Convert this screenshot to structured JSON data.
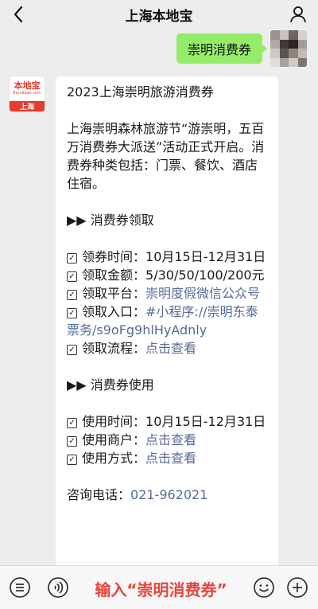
{
  "header": {
    "title": "上海本地宝",
    "back_icon": "chevron-left-icon",
    "profile_icon": "person-icon"
  },
  "outgoing": {
    "text": "崇明消费券"
  },
  "bot": {
    "logo_main": "本地宝",
    "logo_sub": "Bendibao.com",
    "logo_city": "上海"
  },
  "message": {
    "title": "2023上海崇明旅游消费券",
    "intro": "上海崇明森林旅游节“游崇明，五百万消费券大派送”活动正式开启。消费券种类包括：门票、餐饮、酒店住宿。",
    "section1_heading": "▶▶ 消费券领取",
    "get_time_label": "领券时间：",
    "get_time_value": "10月15日-12月31日",
    "amount_label": "领取金额：",
    "amount_value": "5/30/50/100/200元",
    "platform_label": "领取平台：",
    "platform_value": "崇明度假微信公众号",
    "entry_label": "领取入口：",
    "entry_value": "#小程序://崇明东泰票务/s9oFg9hlHyAdnly",
    "process_label": "领取流程：",
    "process_value": "点击查看",
    "section2_heading": "▶▶ 消费券使用",
    "use_time_label": "使用时间：",
    "use_time_value": "10月15日-12月31日",
    "merchant_label": "使用商户：",
    "merchant_value": "点击查看",
    "method_label": "使用方式：",
    "method_value": "点击查看",
    "phone_label": "咨询电话：",
    "phone_value": "021-962021"
  },
  "input_bar": {
    "hint": "输入“崇明消费券”",
    "menu_icon": "menu-list-icon",
    "voice_icon": "voice-icon",
    "emoji_icon": "emoji-icon",
    "plus_icon": "plus-icon"
  },
  "colors": {
    "background": "#ededed",
    "outgoing_bubble": "#95ec69",
    "link": "#576b95",
    "brand_red": "#e63b2e",
    "hint_red": "#e8453c"
  }
}
